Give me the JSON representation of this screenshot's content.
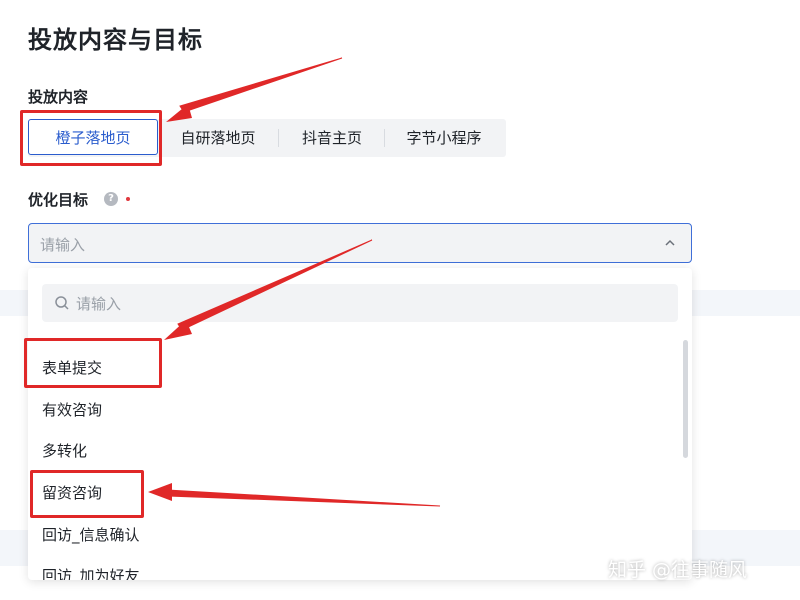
{
  "title": "投放内容与目标",
  "content_section": {
    "label": "投放内容",
    "options": [
      "橙子落地页",
      "自研落地页",
      "抖音主页",
      "字节小程序"
    ],
    "selected": "橙子落地页"
  },
  "goal_section": {
    "label": "优化目标",
    "help_icon": "question-circle-icon",
    "select_placeholder": "请输入",
    "search_placeholder": "请输入",
    "items": [
      "表单提交",
      "有效咨询",
      "多转化",
      "留资咨询",
      "回访_信息确认",
      "回访_加为好友"
    ]
  },
  "watermark": "知乎 @往事随风",
  "colors": {
    "accent": "#2a5ccd",
    "highlight": "#e02828"
  }
}
